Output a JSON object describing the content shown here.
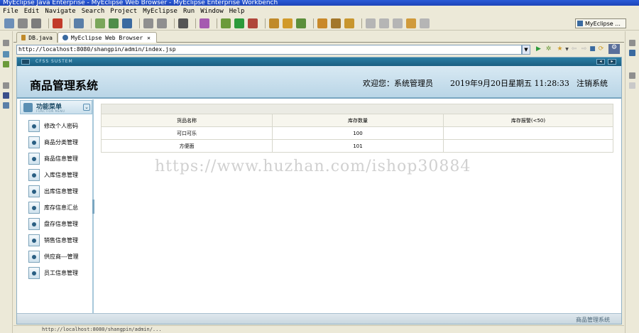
{
  "window": {
    "title": "MyEclipse Java Enterprise - MyEclipse Web Browser - MyEclipse Enterprise Workbench"
  },
  "menubar": [
    "File",
    "Edit",
    "Navigate",
    "Search",
    "Project",
    "MyEclipse",
    "Run",
    "Window",
    "Help"
  ],
  "perspective": {
    "label": "MyEclipse ..."
  },
  "editor_tabs": [
    {
      "label": "DB.java",
      "active": false
    },
    {
      "label": "MyEclipse Web Browser",
      "active": true
    }
  ],
  "browser": {
    "url": "http://localhost:8080/shangpin/admin/index.jsp"
  },
  "app": {
    "strip_label": "CFSS SUSTEM",
    "title": "商品管理系统",
    "welcome": "欢迎您：系统管理员",
    "datetime": "2019年9月20日星期五  11:28:33",
    "logout": "注销系统",
    "footer": "商品管理系统"
  },
  "sidebar": {
    "title": "功能菜单",
    "subtitle": "FUNCTION MENU",
    "items": [
      {
        "label": "修改个人密码"
      },
      {
        "label": "商品分类管理"
      },
      {
        "label": "商品信息管理"
      },
      {
        "label": "入库信息管理"
      },
      {
        "label": "出库信息管理"
      },
      {
        "label": "库存信息汇总"
      },
      {
        "label": "盘存信息管理"
      },
      {
        "label": "销售信息管理"
      },
      {
        "label": "供应商---管理"
      },
      {
        "label": "员工信息管理"
      }
    ]
  },
  "table": {
    "headers": [
      "货品名称",
      "库存数量",
      "库存报警(<50)"
    ],
    "rows": [
      [
        "可口可乐",
        "100",
        ""
      ],
      [
        "方便面",
        "101",
        ""
      ]
    ]
  },
  "watermark": "https://www.huzhan.com/ishop30884",
  "statusbar": "http://localhost:8080/shangpin/admin/..."
}
